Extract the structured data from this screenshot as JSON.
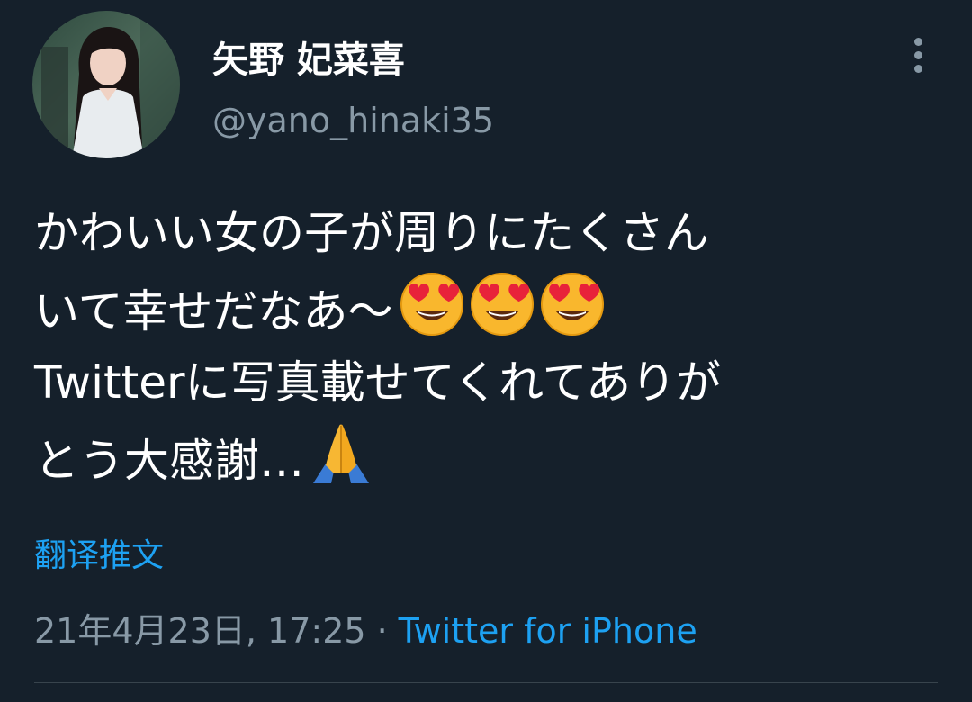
{
  "author": {
    "display_name": "矢野 妃菜喜",
    "handle": "@yano_hinaki35"
  },
  "tweet": {
    "line1": "かわいい女の子が周りにたくさん",
    "line2": "いて幸せだなあ〜",
    "line2_emoji": [
      "heart-eyes",
      "heart-eyes",
      "heart-eyes"
    ],
    "line3": "Twitterに写真載せてくれてありが",
    "line4": "とう大感謝…",
    "line4_emoji": [
      "folded-hands"
    ]
  },
  "translate_label": "翻译推文",
  "meta": {
    "timestamp": "21年4月23日, 17:25",
    "separator": "·",
    "source": "Twitter for iPhone"
  },
  "icons": {
    "more": "more-vertical-icon"
  },
  "colors": {
    "background": "#15202b",
    "text_primary": "#ffffff",
    "text_secondary": "#8899a6",
    "accent": "#1da1f2",
    "divider": "#38444d"
  }
}
